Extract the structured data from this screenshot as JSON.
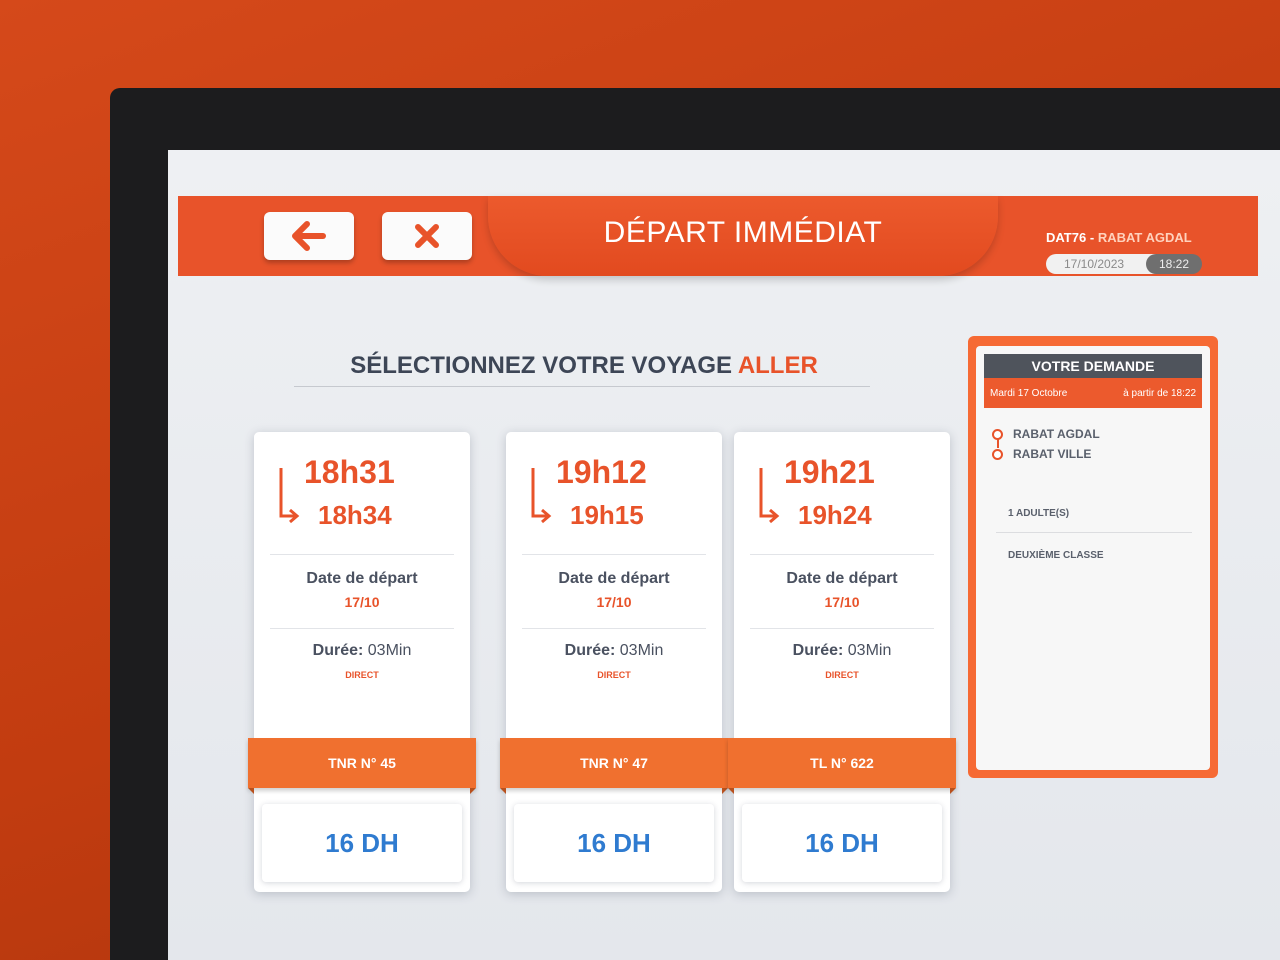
{
  "header": {
    "title": "DÉPART IMMÉDIAT",
    "station_code": "DAT76",
    "separator": "-",
    "station_name": "RABAT AGDAL",
    "date": "17/10/2023",
    "time": "18:22"
  },
  "section": {
    "heading_prefix": "SÉLECTIONNEZ VOTRE VOYAGE",
    "heading_accent": "ALLER"
  },
  "trips": [
    {
      "departure": "18h31",
      "arrival": "18h34",
      "date_label": "Date de départ",
      "date": "17/10",
      "duration_label": "Durée:",
      "duration": "03Min",
      "type": "DIRECT",
      "train": "TNR N° 45",
      "price": "16 DH"
    },
    {
      "departure": "19h12",
      "arrival": "19h15",
      "date_label": "Date de départ",
      "date": "17/10",
      "duration_label": "Durée:",
      "duration": "03Min",
      "type": "DIRECT",
      "train": "TNR N° 47",
      "price": "16 DH"
    },
    {
      "departure": "19h21",
      "arrival": "19h24",
      "date_label": "Date de départ",
      "date": "17/10",
      "duration_label": "Durée:",
      "duration": "03Min",
      "type": "DIRECT",
      "train": "TL N° 622",
      "price": "16 DH"
    }
  ],
  "request": {
    "title": "VOTRE DEMANDE",
    "date": "Mardi 17 Octobre",
    "from_time": "à partir de 18:22",
    "origin": "RABAT AGDAL",
    "destination": "RABAT VILLE",
    "passengers": "1 ADULTE(S)",
    "class": "DEUXIÈME CLASSE"
  },
  "icons": {
    "back": "arrow-left-icon",
    "close": "close-icon",
    "route": "route-arrow-icon"
  },
  "colors": {
    "brand_orange": "#e8532a",
    "price_blue": "#2f7bd0",
    "band_orange": "#f0702f"
  }
}
